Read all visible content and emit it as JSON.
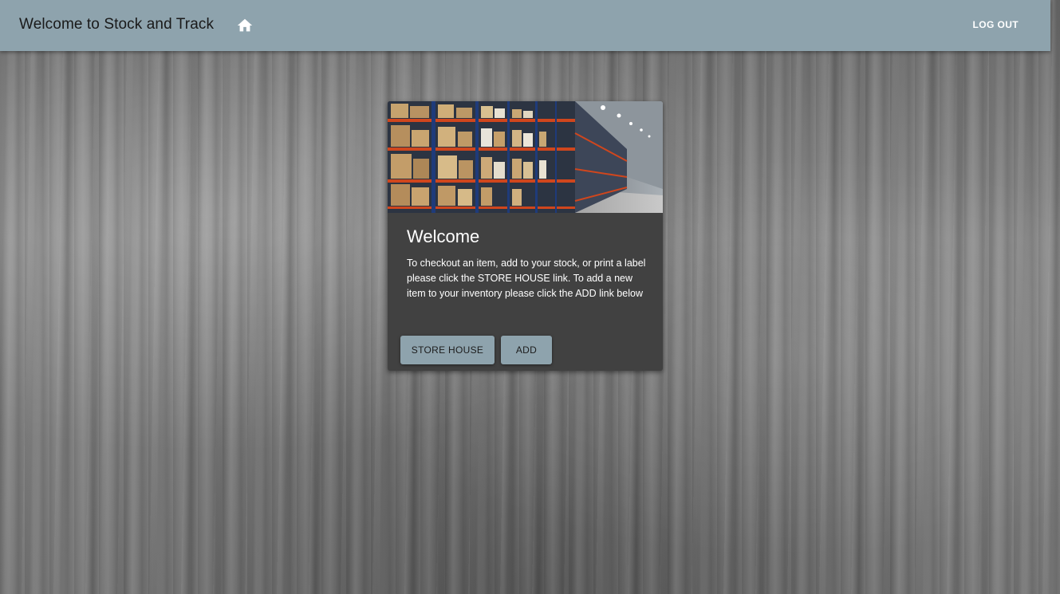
{
  "header": {
    "title": "Welcome to Stock and Track",
    "home_icon": "home-icon",
    "logout_label": "LOG OUT"
  },
  "card": {
    "image": "warehouse-shelves-photo",
    "title": "Welcome",
    "body": "To checkout an item, add to your stock, or print a label please click the STORE HOUSE link. To add a new item to your inventory please click the ADD link below",
    "buttons": {
      "store_house": "STORE HOUSE",
      "add": "ADD"
    }
  },
  "colors": {
    "app_bar": "#8ea3ad",
    "card_bg": "#414141",
    "button_bg": "#8ea3ad"
  }
}
